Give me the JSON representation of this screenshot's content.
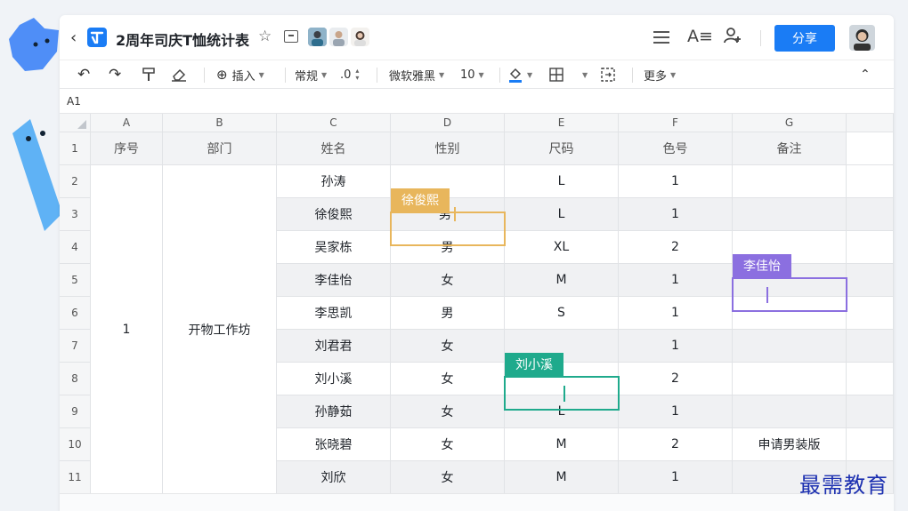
{
  "header": {
    "title": "2周年司庆T恤统计表",
    "share_label": "分享"
  },
  "toolbar": {
    "insert_label": "插入",
    "format_label": "常规",
    "decimal_label": ".0",
    "font_label": "微软雅黑",
    "size_label": "10",
    "more_label": "更多"
  },
  "namebox": "A1",
  "columns": [
    "A",
    "B",
    "C",
    "D",
    "E",
    "F",
    "G"
  ],
  "header_row": [
    "序号",
    "部门",
    "姓名",
    "性别",
    "尺码",
    "色号",
    "备注"
  ],
  "rows": [
    {
      "num": "2",
      "name": "孙涛",
      "gender": "",
      "size": "L",
      "color": "1",
      "note": ""
    },
    {
      "num": "3",
      "name": "徐俊熙",
      "gender": "男",
      "size": "L",
      "color": "1",
      "note": ""
    },
    {
      "num": "4",
      "name": "吴家栋",
      "gender": "男",
      "size": "XL",
      "color": "2",
      "note": ""
    },
    {
      "num": "5",
      "name": "李佳怡",
      "gender": "女",
      "size": "M",
      "color": "1",
      "note": ""
    },
    {
      "num": "6",
      "name": "李思凯",
      "gender": "男",
      "size": "S",
      "color": "1",
      "note": ""
    },
    {
      "num": "7",
      "name": "刘君君",
      "gender": "女",
      "size": "",
      "color": "1",
      "note": ""
    },
    {
      "num": "8",
      "name": "刘小溪",
      "gender": "女",
      "size": "",
      "color": "2",
      "note": ""
    },
    {
      "num": "9",
      "name": "孙静茹",
      "gender": "女",
      "size": "L",
      "color": "1",
      "note": ""
    },
    {
      "num": "10",
      "name": "张晓碧",
      "gender": "女",
      "size": "M",
      "color": "2",
      "note": "申请男装版"
    },
    {
      "num": "11",
      "name": "刘欣",
      "gender": "女",
      "size": "M",
      "color": "1",
      "note": ""
    }
  ],
  "merged": {
    "seq": "1",
    "dept": "开物工作坊"
  },
  "row1_num": "1",
  "collaborators": [
    {
      "name": "徐俊熙",
      "color": "#e8b65c"
    },
    {
      "name": "李佳怡",
      "color": "#8b6fe0"
    },
    {
      "name": "刘小溪",
      "color": "#1faa8c"
    }
  ],
  "accent": "#1a7cf5",
  "watermark": "最需教育"
}
